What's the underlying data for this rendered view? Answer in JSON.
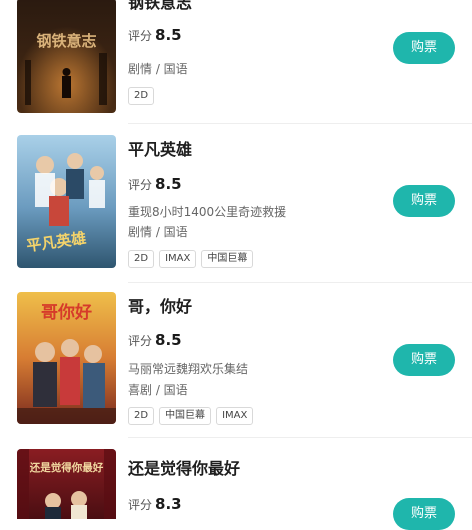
{
  "movies": [
    {
      "title": "钢铁意志",
      "rating_label": "评分",
      "rating": "8.5",
      "desc": "",
      "genre": "剧情 / 国语",
      "tags": [
        "2D"
      ],
      "buy_label": "购票",
      "poster_text": "钢铁意志",
      "colors": {
        "bg_top": "#2a1a10",
        "bg_bottom": "#3d2412",
        "accent": "#c77a2e"
      }
    },
    {
      "title": "平凡英雄",
      "rating_label": "评分",
      "rating": "8.5",
      "desc": "重现8小时1400公里奇迹救援",
      "genre": "剧情 / 国语",
      "tags": [
        "2D",
        "IMAX",
        "中国巨幕"
      ],
      "buy_label": "购票",
      "poster_text": "平凡英雄",
      "colors": {
        "bg_top": "#9cc6e0",
        "bg_bottom": "#3b6b8a",
        "accent": "#f3d36b"
      }
    },
    {
      "title": "哥，你好",
      "rating_label": "评分",
      "rating": "8.5",
      "desc": "马丽常远魏翔欢乐集结",
      "genre": "喜剧 / 国语",
      "tags": [
        "2D",
        "中国巨幕",
        "IMAX"
      ],
      "buy_label": "购票",
      "poster_text": "哥你好",
      "colors": {
        "bg_top": "#e9b23a",
        "bg_bottom": "#b5432a",
        "accent": "#d63a2a"
      }
    },
    {
      "title": "还是觉得你最好",
      "rating_label": "评分",
      "rating": "8.3",
      "desc": "",
      "genre": "",
      "tags": [],
      "buy_label": "购票",
      "poster_text": "还是觉得你最好",
      "colors": {
        "bg_top": "#7a1a1f",
        "bg_bottom": "#3a0c10",
        "accent": "#f1d8a0"
      }
    }
  ],
  "colors": {
    "buy_button": "#1fb6ac",
    "divider": "#eeeeee"
  }
}
